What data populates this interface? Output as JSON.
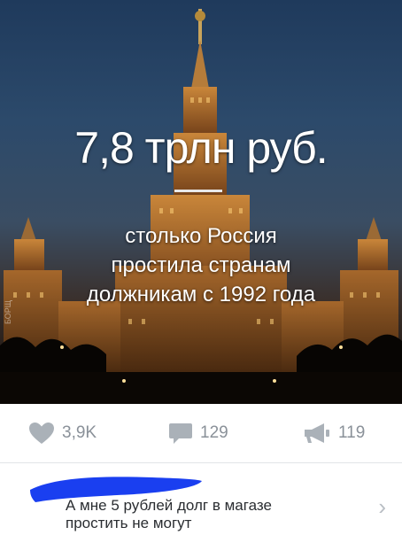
{
  "post": {
    "headline": "7,8 трлн руб.",
    "subtitle_line1": "столько Россия",
    "subtitle_line2": "простила странам",
    "subtitle_line3": "должникам с 1992 года",
    "watermark": "БОРЩ"
  },
  "actions": {
    "likes": "3,9K",
    "comments": "129",
    "reposts": "119"
  },
  "comment": {
    "text_line1": "А мне 5 рублей долг в магазе",
    "text_line2": "простить не могут",
    "author_scribble_color": "#1a3ff0"
  },
  "colors": {
    "icon_gray": "#8a9199",
    "scribble": "#1a3ff0"
  }
}
